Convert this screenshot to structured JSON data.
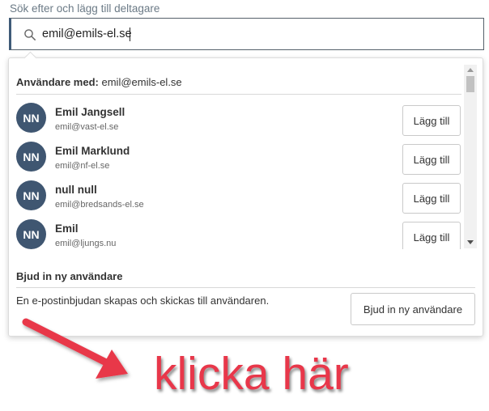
{
  "search": {
    "label": "Sök efter och lägg till deltagare",
    "value": "emil@emils-el.se"
  },
  "results": {
    "header_prefix": "Användare med:",
    "header_query": "emil@emils-el.se",
    "users": [
      {
        "initials": "NN",
        "name": "Emil Jangsell",
        "email": "emil@vast-el.se",
        "button": "Lägg till"
      },
      {
        "initials": "NN",
        "name": "Emil Marklund",
        "email": "emil@nf-el.se",
        "button": "Lägg till"
      },
      {
        "initials": "NN",
        "name": "null null",
        "email": "emil@bredsands-el.se",
        "button": "Lägg till"
      },
      {
        "initials": "NN",
        "name": "Emil",
        "email": "emil@ljungs.nu",
        "button": "Lägg till"
      }
    ]
  },
  "invite": {
    "heading": "Bjud in ny användare",
    "description": "En e-postinbjudan skapas och skickas till användaren.",
    "button": "Bjud in ny användare"
  },
  "annotation": {
    "text": "klicka här",
    "color": "#e8374a"
  },
  "colors": {
    "avatar": "#3f5671",
    "accent_border": "#3f5b78"
  },
  "icons": {
    "search": "search-icon",
    "arrow": "arrow-icon"
  }
}
